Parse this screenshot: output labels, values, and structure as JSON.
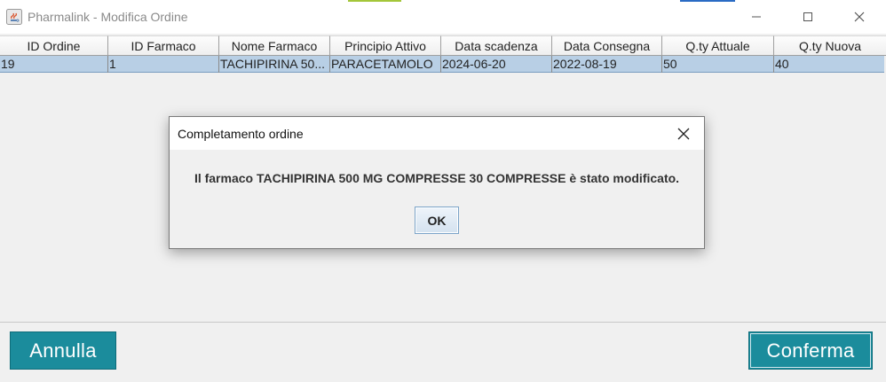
{
  "window": {
    "title": "Pharmalink - Modifica Ordine",
    "minimize_icon": "minimize-icon",
    "maximize_icon": "maximize-icon",
    "close_icon": "close-icon"
  },
  "table": {
    "columns": [
      "ID Ordine",
      "ID Farmaco",
      "Nome Farmaco",
      "Principio Attivo",
      "Data scadenza",
      "Data Consegna",
      "Q.ty Attuale",
      "Q.ty Nuova"
    ],
    "rows": [
      [
        "19",
        "1",
        "TACHIPIRINA 50...",
        "PARACETAMOLO",
        "2024-06-20",
        "2022-08-19",
        "50",
        "40"
      ]
    ]
  },
  "buttons": {
    "cancel": "Annulla",
    "confirm": "Conferma"
  },
  "dialog": {
    "title": "Completamento ordine",
    "message": "Il farmaco TACHIPIRINA 500 MG COMPRESSE 30 COMPRESSE è stato modificato.",
    "ok": "OK"
  },
  "colors": {
    "accent_button": "#1b8c9c",
    "selected_row": "#b8cfe5"
  }
}
